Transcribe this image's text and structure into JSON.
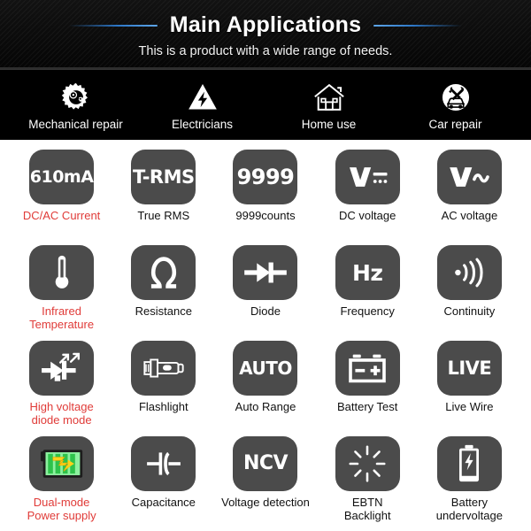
{
  "hero": {
    "title": "Main Applications",
    "subtitle": "This is a product with a wide range of needs.",
    "rule_color": "#2d77c7"
  },
  "applications": [
    {
      "label": "Mechanical repair",
      "icon": "gears-icon"
    },
    {
      "label": "Electricians",
      "icon": "lightning-triangle-icon"
    },
    {
      "label": "Home use",
      "icon": "house-icon"
    },
    {
      "label": "Car repair",
      "icon": "car-repair-icon"
    }
  ],
  "features": [
    {
      "tile_text": "610mA",
      "label": "DC/AC Current",
      "icon": "current-610ma-icon",
      "highlight": true,
      "tile_font": 19
    },
    {
      "tile_text": "T-RMS",
      "label": "True RMS",
      "icon": "true-rms-icon",
      "highlight": false,
      "tile_font": 21
    },
    {
      "tile_text": "9999",
      "label": "9999counts",
      "icon": "counts-9999-icon",
      "highlight": false,
      "tile_font": 24
    },
    {
      "tile_text": "",
      "label": "DC voltage",
      "icon": "dc-voltage-icon",
      "highlight": false,
      "tile_font": 0
    },
    {
      "tile_text": "",
      "label": "AC voltage",
      "icon": "ac-voltage-icon",
      "highlight": false,
      "tile_font": 0
    },
    {
      "tile_text": "",
      "label": "Infrared\nTemperature",
      "icon": "thermometer-icon",
      "highlight": true,
      "tile_font": 0
    },
    {
      "tile_text": "",
      "label": "Resistance",
      "icon": "ohm-icon",
      "highlight": false,
      "tile_font": 0
    },
    {
      "tile_text": "",
      "label": "Diode",
      "icon": "diode-icon",
      "highlight": false,
      "tile_font": 0
    },
    {
      "tile_text": "Hz",
      "label": "Frequency",
      "icon": "frequency-hz-icon",
      "highlight": false,
      "tile_font": 25
    },
    {
      "tile_text": "",
      "label": "Continuity",
      "icon": "continuity-wave-icon",
      "highlight": false,
      "tile_font": 0
    },
    {
      "tile_text": "",
      "label": "High voltage\ndiode mode",
      "icon": "led-diode-icon",
      "highlight": true,
      "tile_font": 0
    },
    {
      "tile_text": "",
      "label": "Flashlight",
      "icon": "flashlight-icon",
      "highlight": false,
      "tile_font": 0
    },
    {
      "tile_text": "AUTO",
      "label": "Auto Range",
      "icon": "auto-range-icon",
      "highlight": false,
      "tile_font": 20
    },
    {
      "tile_text": "",
      "label": "Battery Test",
      "icon": "battery-test-icon",
      "highlight": false,
      "tile_font": 0
    },
    {
      "tile_text": "LIVE",
      "label": "Live Wire",
      "icon": "live-wire-icon",
      "highlight": false,
      "tile_font": 21
    },
    {
      "tile_text": "",
      "label": "Dual-mode\nPower supply",
      "icon": "dual-mode-power-icon",
      "highlight": true,
      "tile_font": 0
    },
    {
      "tile_text": "",
      "label": "Capacitance",
      "icon": "capacitor-icon",
      "highlight": false,
      "tile_font": 0
    },
    {
      "tile_text": "NCV",
      "label": "Voltage detection",
      "icon": "ncv-icon",
      "highlight": false,
      "tile_font": 22
    },
    {
      "tile_text": "",
      "label": "EBTN\nBacklight",
      "icon": "backlight-burst-icon",
      "highlight": false,
      "tile_font": 0
    },
    {
      "tile_text": "",
      "label": "Battery undervoltage",
      "icon": "battery-bolt-icon",
      "highlight": false,
      "tile_font": 0
    }
  ],
  "colors": {
    "tile_bg": "#4b4b4b",
    "highlight_text": "#e03b38",
    "label_text": "#111111",
    "header_bg": "#0b0b0b",
    "page_bg": "#ffffff",
    "battery_green": "#5ddc6e",
    "bolt_yellow": "#ffd21a"
  }
}
